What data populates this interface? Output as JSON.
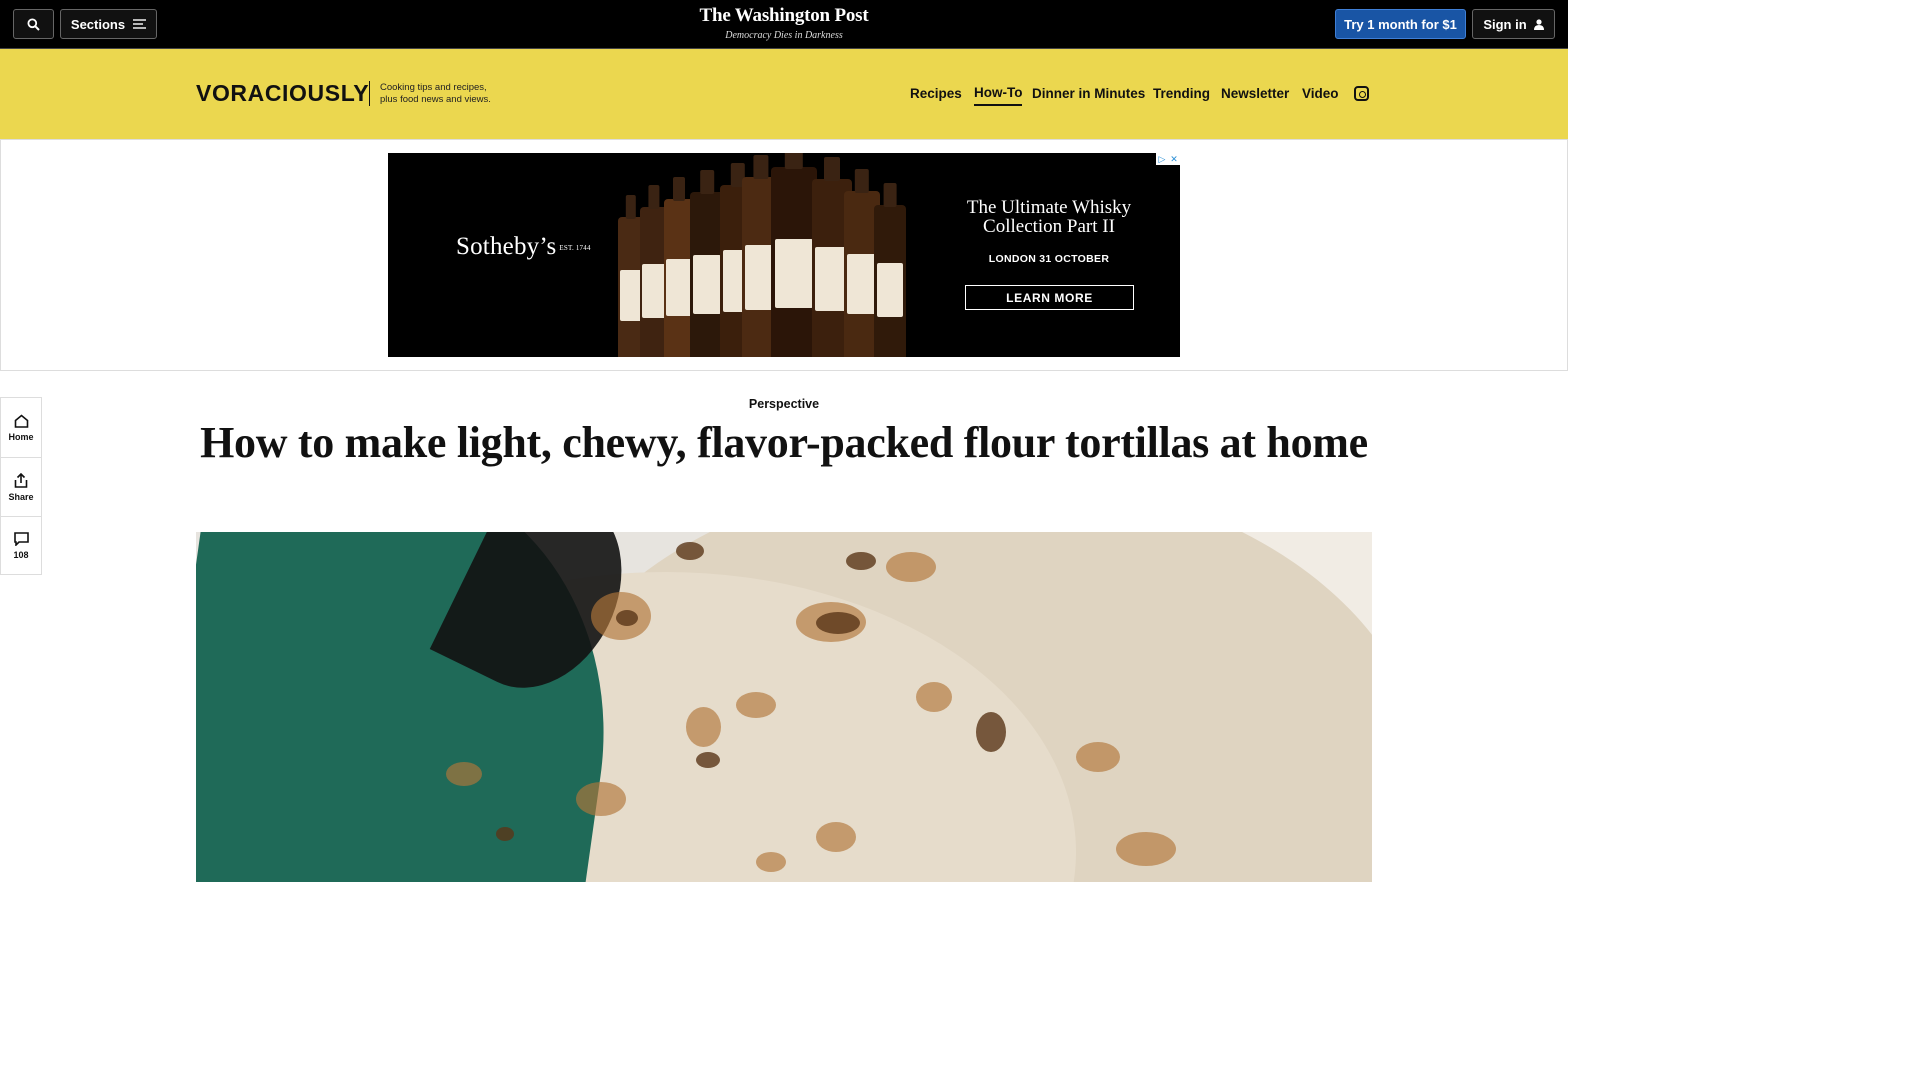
{
  "topbar": {
    "sections_label": "Sections",
    "masthead_title": "The Washington Post",
    "masthead_tagline": "Democracy Dies in Darkness",
    "subscribe_label": "Try 1 month for $1",
    "signin_label": "Sign in",
    "colors": {
      "background": "#000000",
      "subscribe": "#1955a5"
    }
  },
  "section_header": {
    "logo_text": "VORACIOUSLY",
    "description_line1": "Cooking tips and recipes,",
    "description_line2": "plus food news and views.",
    "nav": [
      "Recipes",
      "How-To",
      "Dinner in Minutes",
      "Trending",
      "Newsletter",
      "Video"
    ],
    "active_nav": "How-To",
    "background_color": "#ebd74f",
    "social_icon": "instagram-icon"
  },
  "ad": {
    "brand": "Sotheby’s",
    "brand_est": "EST. 1744",
    "headline": "The Ultimate Whisky Collection Part II",
    "subline": "LONDON 31 OCTOBER",
    "cta": "LEARN MORE",
    "choices_icons": [
      "adchoices-icon",
      "close-icon"
    ]
  },
  "rail": {
    "home_label": "Home",
    "share_label": "Share",
    "comments_count": "108"
  },
  "article": {
    "kicker": "Perspective",
    "headline": "How to make light, chewy, flavor-packed flour tortillas at home",
    "hero_alt": "tortillas-photo"
  }
}
